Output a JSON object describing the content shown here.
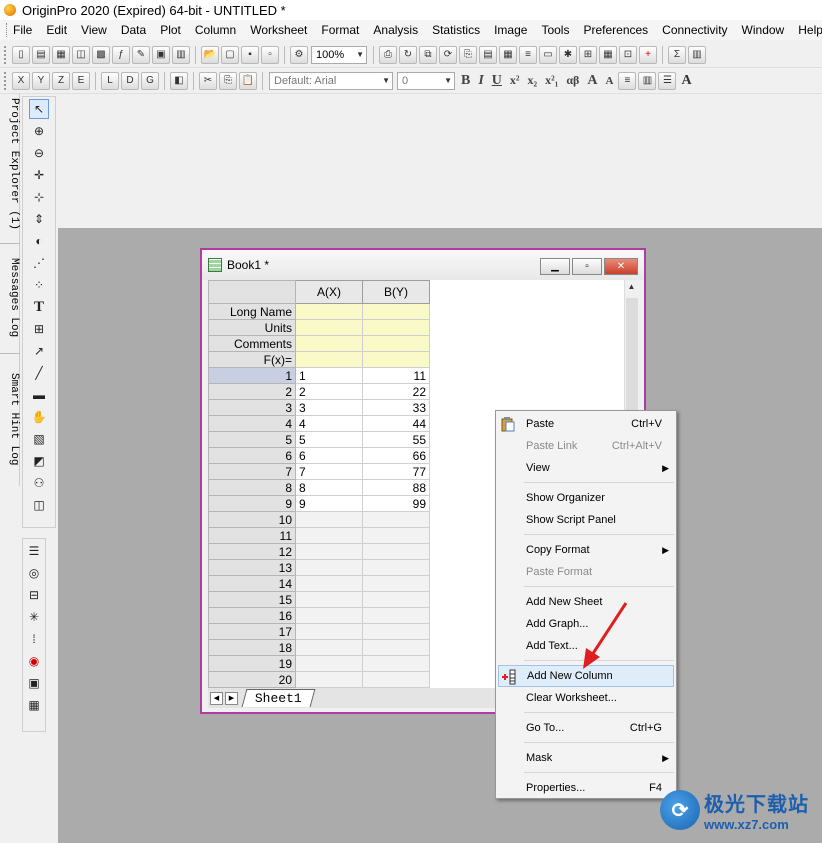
{
  "window": {
    "title": "OriginPro 2020 (Expired) 64-bit - UNTITLED *"
  },
  "menu": [
    "File",
    "Edit",
    "View",
    "Data",
    "Plot",
    "Column",
    "Worksheet",
    "Format",
    "Analysis",
    "Statistics",
    "Image",
    "Tools",
    "Preferences",
    "Connectivity",
    "Window",
    "Help"
  ],
  "toolbar": {
    "zoom": "100%",
    "font": "Default: Arial",
    "font_size": "0"
  },
  "left_tabs": [
    "Project Explorer (1)",
    "Messages Log",
    "Smart Hint Log"
  ],
  "book": {
    "title": "Book1 *",
    "columns": [
      "A(X)",
      "B(Y)"
    ],
    "meta_rows": [
      "Long Name",
      "Units",
      "Comments",
      "F(x)="
    ],
    "rows": [
      {
        "n": "1",
        "a": "1",
        "b": "11"
      },
      {
        "n": "2",
        "a": "2",
        "b": "22"
      },
      {
        "n": "3",
        "a": "3",
        "b": "33"
      },
      {
        "n": "4",
        "a": "4",
        "b": "44"
      },
      {
        "n": "5",
        "a": "5",
        "b": "55"
      },
      {
        "n": "6",
        "a": "6",
        "b": "66"
      },
      {
        "n": "7",
        "a": "7",
        "b": "77"
      },
      {
        "n": "8",
        "a": "8",
        "b": "88"
      },
      {
        "n": "9",
        "a": "9",
        "b": "99"
      },
      {
        "n": "10",
        "a": "",
        "b": ""
      },
      {
        "n": "11",
        "a": "",
        "b": ""
      },
      {
        "n": "12",
        "a": "",
        "b": ""
      },
      {
        "n": "13",
        "a": "",
        "b": ""
      },
      {
        "n": "14",
        "a": "",
        "b": ""
      },
      {
        "n": "15",
        "a": "",
        "b": ""
      },
      {
        "n": "16",
        "a": "",
        "b": ""
      },
      {
        "n": "17",
        "a": "",
        "b": ""
      },
      {
        "n": "18",
        "a": "",
        "b": ""
      },
      {
        "n": "19",
        "a": "",
        "b": ""
      },
      {
        "n": "20",
        "a": "",
        "b": ""
      }
    ],
    "sheet_tab": "Sheet1"
  },
  "context_menu": [
    {
      "label": "Paste",
      "shortcut": "Ctrl+V",
      "icon": "paste-icon"
    },
    {
      "label": "Paste Link",
      "shortcut": "Ctrl+Alt+V",
      "disabled": true
    },
    {
      "label": "View",
      "submenu": true
    },
    {
      "sep": true
    },
    {
      "label": "Show Organizer"
    },
    {
      "label": "Show Script Panel"
    },
    {
      "sep": true
    },
    {
      "label": "Copy Format",
      "submenu": true
    },
    {
      "label": "Paste Format",
      "disabled": true
    },
    {
      "sep": true
    },
    {
      "label": "Add New Sheet"
    },
    {
      "label": "Add Graph..."
    },
    {
      "label": "Add Text..."
    },
    {
      "sep": true
    },
    {
      "label": "Add New Column",
      "highlighted": true,
      "icon": "add-column-icon"
    },
    {
      "label": "Clear Worksheet..."
    },
    {
      "sep": true
    },
    {
      "label": "Go To...",
      "shortcut": "Ctrl+G"
    },
    {
      "sep": true
    },
    {
      "label": "Mask",
      "submenu": true
    },
    {
      "sep": true
    },
    {
      "label": "Properties...",
      "shortcut": "F4"
    }
  ],
  "watermark": {
    "name": "极光下载站",
    "url": "www.xz7.com"
  },
  "colors": {
    "book_border": "#b03ca0",
    "meta_fill": "#fafac8",
    "arrow": "#e02020",
    "highlight": "#dfecfa"
  }
}
